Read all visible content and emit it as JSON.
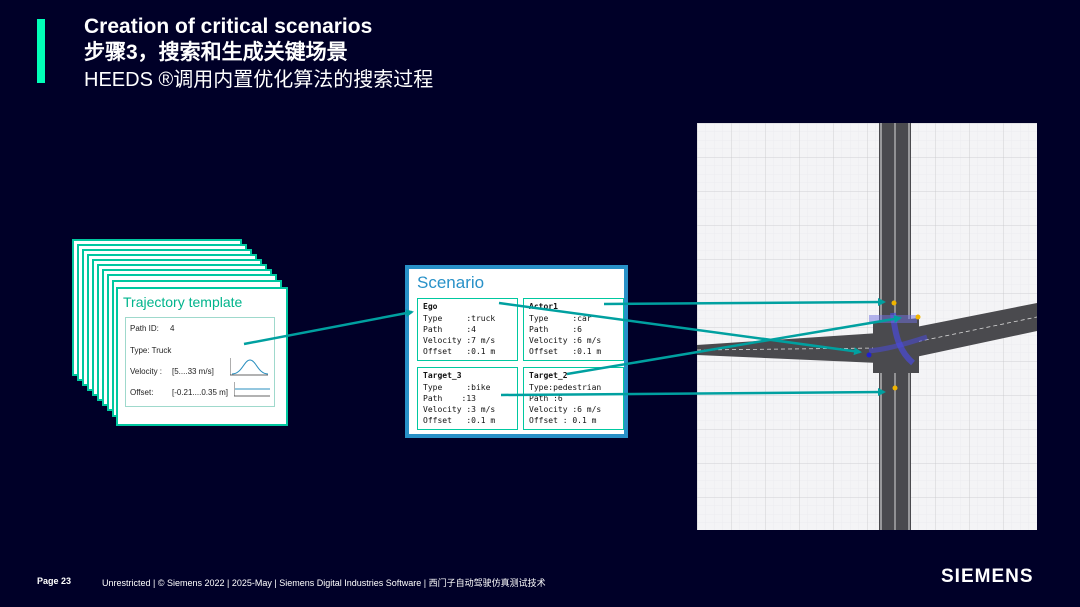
{
  "header": {
    "title": "Creation of critical scenarios",
    "subtitle": "步骤3，搜索和生成关键场景",
    "subtitle2": "HEEDS ®调用内置优化算法的搜索过程"
  },
  "template": {
    "title": "Trajectory template",
    "path_id_label": "Path ID:",
    "path_id_value": "4",
    "type_label": "Type: Truck",
    "velocity_label": "Velocity :",
    "velocity_value": "[5....33 m/s]",
    "offset_label": "Offset:",
    "offset_value": "[-0.21....0.35 m]"
  },
  "scenario": {
    "title": "Scenario",
    "actors": [
      {
        "name": "Ego",
        "lines": [
          "Type     :truck",
          "Path     :4",
          "Velocity :7 m/s",
          "Offset   :0.1 m"
        ]
      },
      {
        "name": "Actor1",
        "lines": [
          "Type     :car",
          "Path     :6",
          "Velocity :6 m/s",
          "Offset   :0.1 m"
        ]
      },
      {
        "name": "Target_3",
        "lines": [
          "Type     :bike",
          "Path    :13",
          "Velocity :3 m/s",
          "Offset   :0.1 m"
        ]
      },
      {
        "name": "Target_2",
        "lines": [
          "Type:pedestrian",
          "Path :6",
          "Velocity :6 m/s",
          "Offset : 0.1 m"
        ]
      }
    ]
  },
  "footer": {
    "page": "Page 23",
    "text": "Unrestricted | © Siemens 2022 | 2025-May | Siemens Digital Industries Software | 西门子自动驾驶仿真测试技术",
    "logo": "SIEMENS"
  },
  "colors": {
    "background": "#000028",
    "accent": "#00ffb9",
    "teal": "#00a0a0",
    "scenario_border": "#2891c8"
  }
}
